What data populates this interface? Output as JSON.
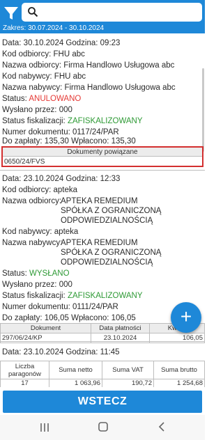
{
  "header": {
    "date_range": "Zakres: 30.07.2024 - 30.10.2024",
    "search": {
      "value": "",
      "placeholder": ""
    },
    "icons": {
      "filter": "filter-icon",
      "search": "search-icon"
    }
  },
  "cards": [
    {
      "date_line": "Data:  30.10.2024  Godzina:  09:23",
      "kod_odbiorcy": "Kod odbiorcy:  FHU abc",
      "nazwa_odbiorcy": "Nazwa odbiorcy:  Firma Handlowo Usługowa abc",
      "kod_nabywcy": "Kod nabywcy:  FHU abc",
      "nazwa_nabywcy": "Nazwa nabywcy:  Firma Handlowo Usługowa abc",
      "status_label": "Status:",
      "status_value": "ANULOWANO",
      "wyslano": "Wysłano przez:  000",
      "fiskal_label": "Status fiskalizacji:",
      "fiskal_value": "ZAFISKALIZOWANY",
      "numer": "Numer dokumentu:  0117/24/PAR",
      "platnosc": "Do zapłaty:  135,30   Wpłacono:  135,30",
      "related_title": "Dokumenty powiązane",
      "related_value": "0650/24/FVS"
    },
    {
      "date_line": "Data:  23.10.2024  Godzina:  12:33",
      "kod_odbiorcy": "Kod odbiorcy:  apteka",
      "nazwa_odbiorcy_label": "Nazwa odbiorcy:",
      "nazwa_odbiorcy_lines": [
        "APTEKA REMEDIUM",
        "SPÓŁKA Z OGRANICZONĄ",
        "ODPOWIEDZIALNOŚCIĄ"
      ],
      "kod_nabywcy": "Kod nabywcy:  apteka",
      "nazwa_nabywcy_label": "Nazwa nabywcy:",
      "nazwa_nabywcy_lines": [
        "APTEKA REMEDIUM",
        "SPÓŁKA Z OGRANICZONĄ",
        "ODPOWIEDZIALNOŚCIĄ"
      ],
      "status_label": "Status:",
      "status_value": "WYSŁANO",
      "wyslano": "Wysłano przez:  000",
      "fiskal_label": "Status fiskalizacji:",
      "fiskal_value": "ZAFISKALIZOWANY",
      "numer": "Numer dokumentu:  0111/24/PAR",
      "platnosc": "Do zapłaty:  106,05   Wpłacono:  106,05",
      "docs_table": {
        "headers": [
          "Dokument",
          "Data płatności",
          "Kwota"
        ],
        "rows": [
          [
            "297/06/24/KP",
            "23.10.2024",
            "106,05"
          ]
        ]
      }
    },
    {
      "date_line": "Data:  23.10.2024  Godzina:  11:45",
      "summary": {
        "headers": [
          "Liczba paragonów",
          "Suma netto",
          "Suma VAT",
          "Suma brutto"
        ],
        "values": [
          "17",
          "1 063,96",
          "190,72",
          "1 254,68"
        ]
      }
    }
  ],
  "fab": {
    "label": "+"
  },
  "back_button": "WSTECZ",
  "colors": {
    "primary": "#1e88d8",
    "cancelled": "#e53935",
    "ok": "#2e9a35",
    "highlight_border": "#d32f2f"
  },
  "nav_icons": [
    "recent-apps-icon",
    "home-icon",
    "back-icon"
  ]
}
